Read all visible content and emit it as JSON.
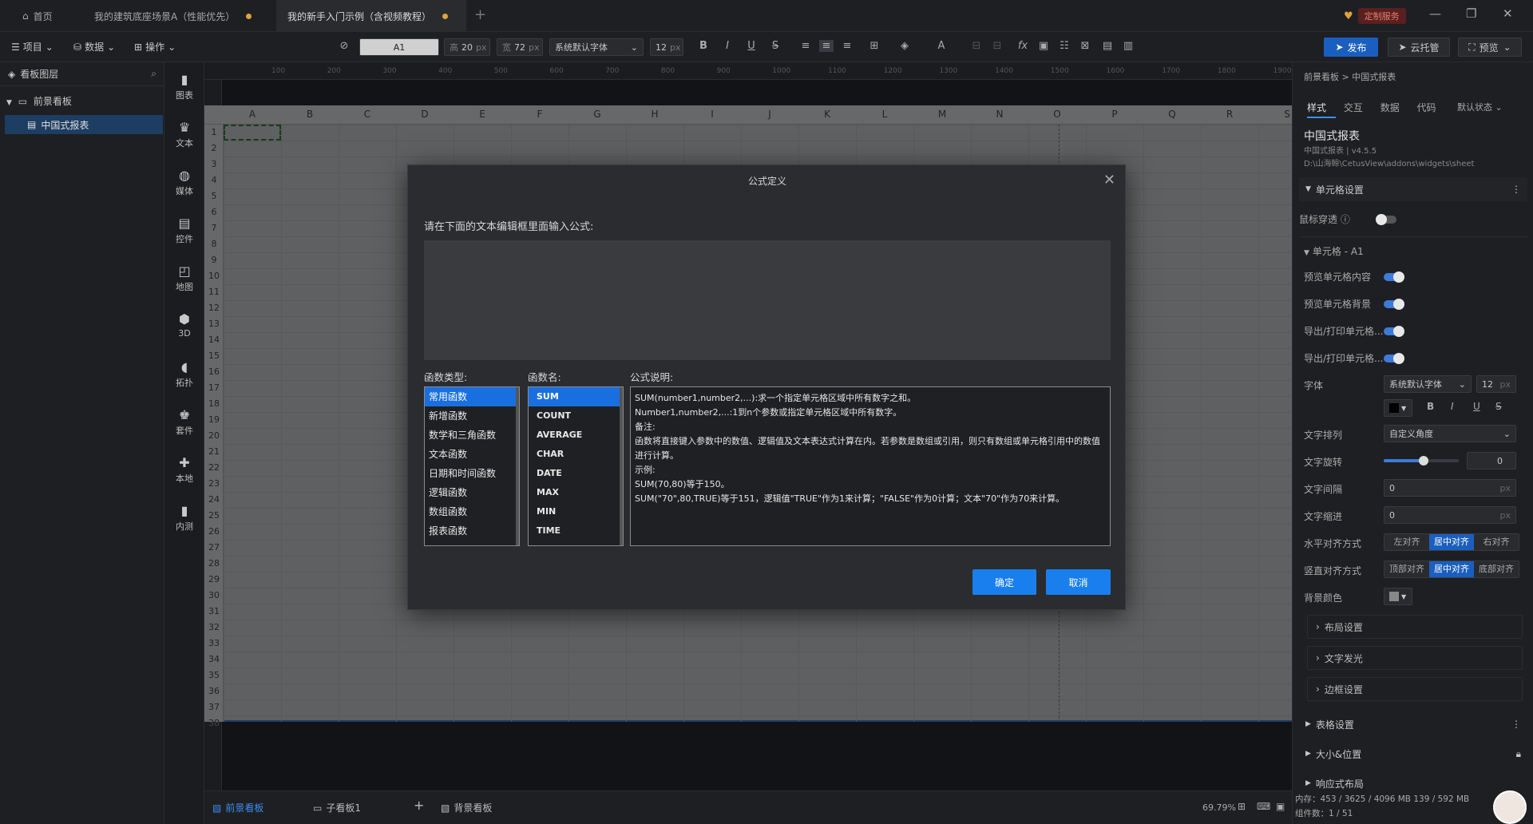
{
  "titlebar": {
    "home": "首页",
    "tabs": [
      {
        "label": "我的建筑底座场景A（性能优先）"
      },
      {
        "label": "我的新手入门示例（含视频教程）"
      }
    ],
    "service_label": "定制服务"
  },
  "toolbar": {
    "menus": [
      "项目",
      "数据",
      "操作"
    ],
    "cell_ref": "A1",
    "height_label": "高",
    "height_value": "20",
    "width_label": "宽",
    "width_value": "72",
    "unit": "px",
    "font_family": "系统默认字体",
    "font_size": "12",
    "publish": "发布",
    "cloud": "云托管",
    "preview": "预览"
  },
  "layers": {
    "title": "看板图层",
    "root": "前景看板",
    "item": "中国式报表"
  },
  "rail": [
    "图表",
    "文本",
    "媒体",
    "控件",
    "地图",
    "3D",
    "拓扑",
    "套件",
    "本地",
    "内测"
  ],
  "ruler": [
    "100",
    "200",
    "300",
    "400",
    "500",
    "600",
    "700",
    "800",
    "900",
    "1000",
    "1100",
    "1200",
    "1300",
    "1400",
    "1500",
    "1600",
    "1700",
    "1800",
    "1900"
  ],
  "sheet": {
    "columns": [
      "A",
      "B",
      "C",
      "D",
      "E",
      "F",
      "G",
      "H",
      "I",
      "J",
      "K",
      "L",
      "M",
      "N",
      "O",
      "P",
      "Q",
      "R",
      "S"
    ],
    "rows": [
      "1",
      "2",
      "3",
      "4",
      "5",
      "6",
      "7",
      "8",
      "9",
      "10",
      "11",
      "12",
      "13",
      "14",
      "15",
      "16",
      "17",
      "18",
      "19",
      "20",
      "21",
      "22",
      "23",
      "24",
      "25",
      "26",
      "27",
      "28",
      "29",
      "30",
      "31",
      "32",
      "33",
      "34",
      "35",
      "36",
      "37",
      "38"
    ]
  },
  "bottombar": {
    "tabs": [
      "前景看板",
      "子看板1",
      "背景看板"
    ],
    "zoom": "69.79%"
  },
  "rpanel": {
    "breadcrumb": "前景看板 > 中国式报表",
    "tabs": [
      "样式",
      "交互",
      "数据",
      "代码"
    ],
    "state": "默认状态",
    "component_name": "中国式报表",
    "component_version": "中国式报表 | v4.5.5",
    "component_path": "D:\\山海鲸\\CetusView\\addons\\widgets\\sheet",
    "cell_settings": "单元格设置",
    "mouse_pass": "鼠标穿透",
    "cell_group": "单元格 - A1",
    "preview_content": "预览单元格内容",
    "preview_bg": "预览单元格背景",
    "export1": "导出/打印单元格...",
    "export2": "导出/打印单元格...",
    "font_label": "字体",
    "font_value": "系统默认字体",
    "font_size": "12",
    "text_arrange": "文字排列",
    "text_arrange_value": "自定义角度",
    "text_rotate": "文字旋转",
    "text_rotate_value": "0",
    "text_spacing": "文字间隔",
    "text_spacing_value": "0",
    "text_indent": "文字缩进",
    "text_indent_value": "0",
    "h_align": "水平对齐方式",
    "h_align_opts": [
      "左对齐",
      "居中对齐",
      "右对齐"
    ],
    "v_align": "竖直对齐方式",
    "v_align_opts": [
      "顶部对齐",
      "居中对齐",
      "底部对齐"
    ],
    "bg_color": "背景颜色",
    "layout": "布局设置",
    "glow": "文字发光",
    "border": "边框设置",
    "table_settings": "表格设置",
    "size_pos": "大小&位置",
    "responsive": "响应式布局",
    "status_mem": "内存：453 / 3625 / 4096 MB  139 / 592 MB",
    "status_count": "组件数：1 / 51"
  },
  "modal": {
    "title": "公式定义",
    "prompt": "请在下面的文本编辑框里面输入公式:",
    "type_label": "函数类型:",
    "name_label": "函数名:",
    "desc_label": "公式说明:",
    "types": [
      "常用函数",
      "新增函数",
      "数学和三角函数",
      "文本函数",
      "日期和时间函数",
      "逻辑函数",
      "数组函数",
      "报表函数"
    ],
    "functions": [
      "SUM",
      "COUNT",
      "AVERAGE",
      "CHAR",
      "DATE",
      "MAX",
      "MIN",
      "TIME"
    ],
    "desc_lines": [
      "SUM(number1,number2,...):求一个指定单元格区域中所有数字之和。",
      "Number1,number2,...:1到n个参数或指定单元格区域中所有数字。",
      "备注:",
      "函数将直接键入参数中的数值、逻辑值及文本表达式计算在内。若参数是数组或引用，则只有数组或单元格引用中的数值进行计算。",
      "示例:",
      "SUM(70,80)等于150。",
      "SUM(\"70\",80,TRUE)等于151，逻辑值\"TRUE\"作为1来计算；\"FALSE\"作为0计算；文本\"70\"作为70来计算。"
    ],
    "ok": "确定",
    "cancel": "取消"
  }
}
